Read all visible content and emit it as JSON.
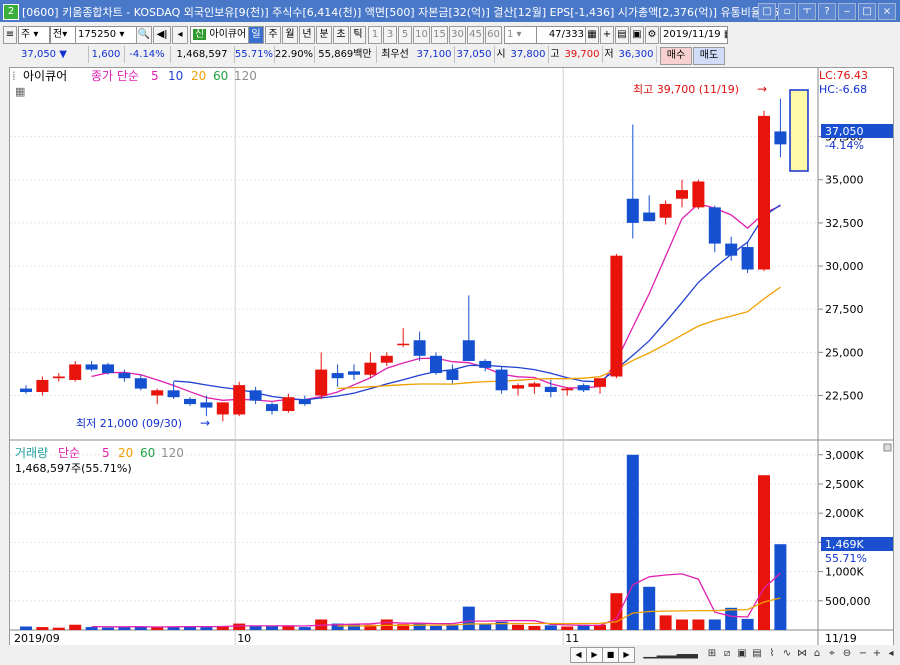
{
  "window": {
    "screen_no": "2",
    "title": "[0600] 키움종합차트 - KOSDAQ 외국인보유[9(천)] 주식수[6,414(천)] 액면[500] 자본금[32(억)] 결산[12월] EPS[-1,436] 시가총액[2,376(억)] 유통비율[75",
    "buttons": [
      "□",
      "▫",
      "ㅜ",
      "?",
      "‒",
      "□",
      "×"
    ]
  },
  "toolbar": {
    "main_label": "주",
    "all_label": "전",
    "code": "175250",
    "name": "아이큐어",
    "name_badge": "신",
    "periods": [
      "일",
      "주",
      "월",
      "년",
      "분",
      "초",
      "틱"
    ],
    "active_period": "일",
    "intervals": [
      "1",
      "3",
      "5",
      "10",
      "15",
      "30",
      "45",
      "60"
    ],
    "interval_value": "1",
    "count": "47/333",
    "date": "2019/11/19"
  },
  "quote": {
    "price": "37,050",
    "change": "1,600",
    "change_pct": "-4.14%",
    "volume": "1,468,597",
    "volume_pct": "55.71%",
    "turnover": "22.90%",
    "amount": "55,869백만",
    "best_ask_label": "최우선",
    "best_ask": "37,100",
    "best_bid": "37,050",
    "open_label": "시",
    "open": "37,800",
    "high_label": "고",
    "high": "39,700",
    "low_label": "저",
    "low": "36,300",
    "buy_label": "매수",
    "sell_label": "매도"
  },
  "price_panel": {
    "stock_name": "아이큐어",
    "ma_label": "종가 단순",
    "ma_periods": [
      "5",
      "10",
      "20",
      "60",
      "120"
    ],
    "ma_colors": [
      "#e020b0",
      "#2040d0",
      "#f0a000",
      "#20a040",
      "#909090"
    ],
    "lc": "LC:76.43",
    "hc": "HC:-6.68",
    "cur_price": "37,050",
    "cur_pct": "-4.14%",
    "high_annot": "최고 39,700 (11/19)",
    "low_annot": "최저 21,000 (09/30)"
  },
  "volume_panel": {
    "title": "거래량",
    "ma_label": "단순",
    "ma_periods": [
      "5",
      "20",
      "60",
      "120"
    ],
    "info": "1,468,597주(55.71%)",
    "cur_vol": "1,469K",
    "cur_pct": "55.71%"
  },
  "chart_data": {
    "type": "candlestick",
    "price_ticks": [
      "37,500",
      "35,000",
      "32,500",
      "30,000",
      "27,500",
      "25,000",
      "22,500"
    ],
    "price_tick_values": [
      37500,
      35000,
      32500,
      30000,
      27500,
      25000,
      22500
    ],
    "volume_ticks": [
      "3,000K",
      "2,500K",
      "2,000K",
      "1,500K",
      "1,000K",
      "500,000"
    ],
    "volume_tick_values": [
      3000000,
      2500000,
      2000000,
      1500000,
      1000000,
      500000
    ],
    "x_labels": [
      {
        "label": "2019/09",
        "index": 0
      },
      {
        "label": "10",
        "index": 13
      },
      {
        "label": "11",
        "index": 33
      },
      {
        "label": "11/19",
        "index": 46
      }
    ],
    "candles": [
      {
        "o": 22900,
        "h": 23100,
        "l": 22600,
        "c": 22700,
        "v": 60000
      },
      {
        "o": 22700,
        "h": 23600,
        "l": 22500,
        "c": 23400,
        "v": 50000
      },
      {
        "o": 23500,
        "h": 23800,
        "l": 23300,
        "c": 23600,
        "v": 40000
      },
      {
        "o": 23400,
        "h": 24500,
        "l": 23300,
        "c": 24300,
        "v": 90000
      },
      {
        "o": 24300,
        "h": 24500,
        "l": 23900,
        "c": 24000,
        "v": 50000
      },
      {
        "o": 24300,
        "h": 24400,
        "l": 23700,
        "c": 23800,
        "v": 40000
      },
      {
        "o": 23800,
        "h": 24000,
        "l": 23300,
        "c": 23500,
        "v": 50000
      },
      {
        "o": 23500,
        "h": 23700,
        "l": 22800,
        "c": 22900,
        "v": 60000
      },
      {
        "o": 22500,
        "h": 22900,
        "l": 22000,
        "c": 22800,
        "v": 60000
      },
      {
        "o": 22800,
        "h": 23300,
        "l": 22300,
        "c": 22400,
        "v": 60000
      },
      {
        "o": 22300,
        "h": 22400,
        "l": 21900,
        "c": 22000,
        "v": 60000
      },
      {
        "o": 22100,
        "h": 22500,
        "l": 21300,
        "c": 21800,
        "v": 50000
      },
      {
        "o": 21400,
        "h": 22000,
        "l": 21000,
        "c": 22100,
        "v": 70000
      },
      {
        "o": 21400,
        "h": 23300,
        "l": 21300,
        "c": 23100,
        "v": 110000
      },
      {
        "o": 22800,
        "h": 23000,
        "l": 22000,
        "c": 22200,
        "v": 60000
      },
      {
        "o": 22000,
        "h": 22100,
        "l": 21400,
        "c": 21600,
        "v": 60000
      },
      {
        "o": 21600,
        "h": 22600,
        "l": 21500,
        "c": 22400,
        "v": 60000
      },
      {
        "o": 22300,
        "h": 22500,
        "l": 21900,
        "c": 22000,
        "v": 50000
      },
      {
        "o": 22500,
        "h": 25000,
        "l": 22300,
        "c": 24000,
        "v": 180000
      },
      {
        "o": 23800,
        "h": 24300,
        "l": 23000,
        "c": 23500,
        "v": 110000
      },
      {
        "o": 23900,
        "h": 24300,
        "l": 23400,
        "c": 23700,
        "v": 100000
      },
      {
        "o": 23700,
        "h": 25000,
        "l": 23500,
        "c": 24400,
        "v": 90000
      },
      {
        "o": 24400,
        "h": 25000,
        "l": 24200,
        "c": 24800,
        "v": 180000
      },
      {
        "o": 25500,
        "h": 26400,
        "l": 25300,
        "c": 25500,
        "v": 100000
      },
      {
        "o": 25700,
        "h": 26200,
        "l": 24500,
        "c": 24800,
        "v": 110000
      },
      {
        "o": 24800,
        "h": 25000,
        "l": 23700,
        "c": 23800,
        "v": 70000
      },
      {
        "o": 24000,
        "h": 24300,
        "l": 23200,
        "c": 23400,
        "v": 80000
      },
      {
        "o": 25700,
        "h": 28300,
        "l": 25000,
        "c": 24500,
        "v": 400000
      },
      {
        "o": 24500,
        "h": 24600,
        "l": 23900,
        "c": 24100,
        "v": 100000
      },
      {
        "o": 24000,
        "h": 24200,
        "l": 22600,
        "c": 22800,
        "v": 140000
      },
      {
        "o": 22900,
        "h": 23200,
        "l": 22500,
        "c": 23100,
        "v": 90000
      },
      {
        "o": 23000,
        "h": 23300,
        "l": 22600,
        "c": 23200,
        "v": 70000
      },
      {
        "o": 23000,
        "h": 23400,
        "l": 22400,
        "c": 22700,
        "v": 80000
      },
      {
        "o": 22800,
        "h": 23000,
        "l": 22500,
        "c": 22900,
        "v": 60000
      },
      {
        "o": 23100,
        "h": 23200,
        "l": 22700,
        "c": 22800,
        "v": 90000
      },
      {
        "o": 23000,
        "h": 23300,
        "l": 22600,
        "c": 23500,
        "v": 90000
      },
      {
        "o": 23600,
        "h": 30700,
        "l": 23500,
        "c": 30600,
        "v": 630000
      },
      {
        "o": 33900,
        "h": 38200,
        "l": 31600,
        "c": 32500,
        "v": 3000000
      },
      {
        "o": 33100,
        "h": 34100,
        "l": 32600,
        "c": 32600,
        "v": 740000
      },
      {
        "o": 32800,
        "h": 33800,
        "l": 32400,
        "c": 33600,
        "v": 250000
      },
      {
        "o": 33900,
        "h": 35000,
        "l": 33400,
        "c": 34400,
        "v": 180000
      },
      {
        "o": 33400,
        "h": 35000,
        "l": 33300,
        "c": 34900,
        "v": 180000
      },
      {
        "o": 33400,
        "h": 33500,
        "l": 30800,
        "c": 31300,
        "v": 180000
      },
      {
        "o": 31300,
        "h": 31700,
        "l": 30300,
        "c": 30600,
        "v": 380000
      },
      {
        "o": 31100,
        "h": 31400,
        "l": 29600,
        "c": 29800,
        "v": 190000
      },
      {
        "o": 29800,
        "h": 39000,
        "l": 29700,
        "c": 38700,
        "v": 2650000
      },
      {
        "o": 37800,
        "h": 39700,
        "l": 36300,
        "c": 37050,
        "v": 1468597
      }
    ]
  }
}
